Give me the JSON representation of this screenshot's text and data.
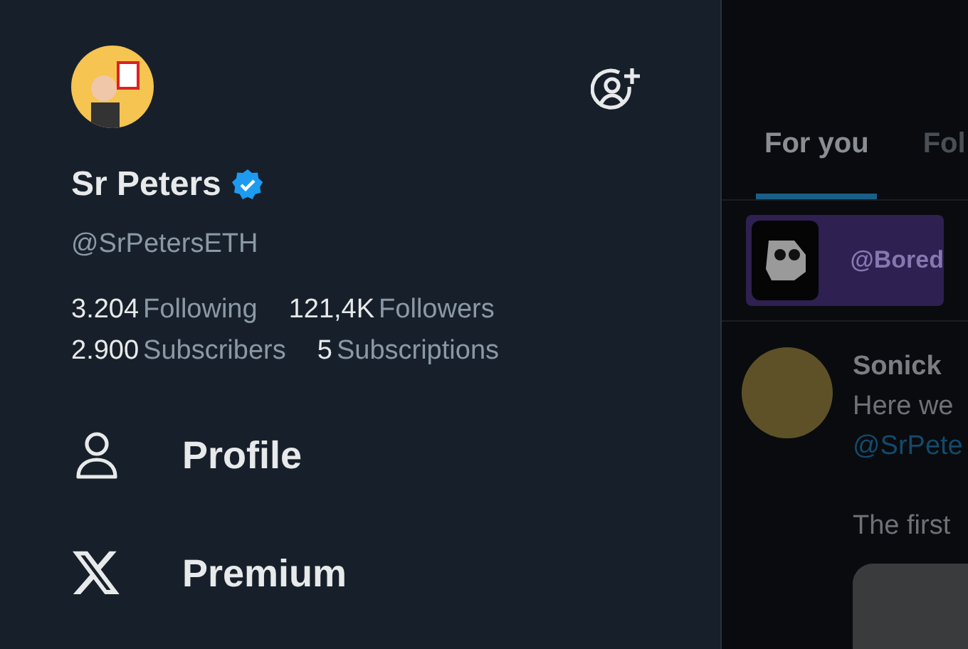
{
  "drawer": {
    "name": "Sr Peters",
    "verified": true,
    "handle": "@SrPetersETH",
    "stats": [
      {
        "count": "3.204",
        "noun": "Following"
      },
      {
        "count": "121,4K",
        "noun": "Followers"
      },
      {
        "count": "2.900",
        "noun": "Subscribers"
      },
      {
        "count": "5",
        "noun": "Subscriptions"
      }
    ],
    "menu": [
      {
        "kind": "profile",
        "label": "Profile"
      },
      {
        "kind": "premium",
        "label": "Premium"
      }
    ]
  },
  "feed": {
    "tabs": [
      {
        "label": "For you",
        "selected": true
      },
      {
        "label": "Fol",
        "selected": false
      }
    ],
    "banner": {
      "handle": "@Bored"
    },
    "post": {
      "author": "Sonick",
      "lines": [
        {
          "kind": "text",
          "text": "Here we"
        },
        {
          "kind": "mention",
          "text": "@SrPete"
        },
        {
          "kind": "gap"
        },
        {
          "kind": "text",
          "text": "The first"
        }
      ]
    }
  }
}
